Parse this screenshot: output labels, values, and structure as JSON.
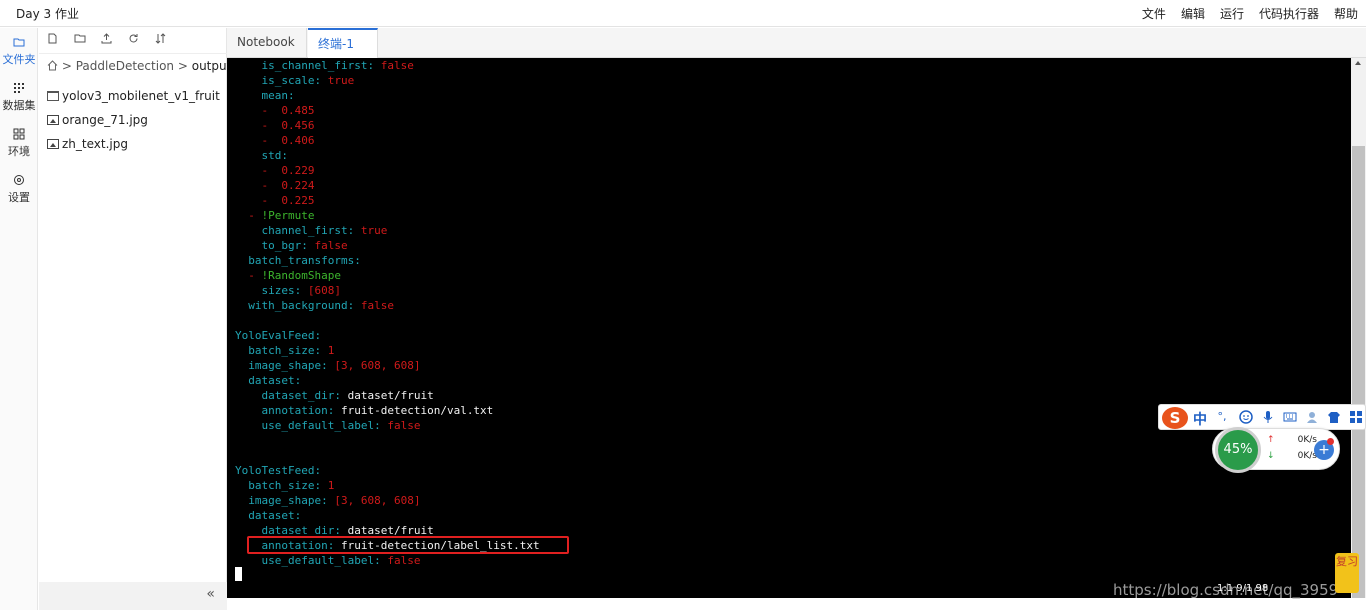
{
  "window": {
    "title": "Day 3 作业"
  },
  "menu": [
    "文件",
    "编辑",
    "运行",
    "代码执行器",
    "帮助"
  ],
  "sidebar": [
    {
      "label": "文件夹",
      "icon": "folder-icon",
      "active": true
    },
    {
      "label": "数据集",
      "icon": "dataset-icon",
      "active": false
    },
    {
      "label": "环境",
      "icon": "environment-icon",
      "active": false
    },
    {
      "label": "设置",
      "icon": "settings-icon",
      "active": false
    }
  ],
  "filepanel": {
    "toolbar_icons": [
      "new-file-icon",
      "new-folder-icon",
      "upload-icon",
      "refresh-icon",
      "sort-icon"
    ],
    "breadcrumb": {
      "root_icon": "home-icon",
      "sep": ">",
      "parent": "PaddleDetection",
      "current": "output"
    },
    "items": [
      {
        "name": "yolov3_mobilenet_v1_fruit",
        "type": "folder"
      },
      {
        "name": "orange_71.jpg",
        "type": "image"
      },
      {
        "name": "zh_text.jpg",
        "type": "image"
      }
    ],
    "collapse": "«"
  },
  "tabs": [
    {
      "label": "Notebook",
      "active": false
    },
    {
      "label": "终端-1",
      "active": true,
      "close": "×"
    }
  ],
  "terminal": {
    "lines": [
      {
        "indent": "    ",
        "key": "is_channel_first",
        "value": "false"
      },
      {
        "indent": "    ",
        "key": "is_scale",
        "value": "true"
      },
      {
        "indent": "    ",
        "key": "mean",
        "value": ""
      },
      {
        "indent": "    ",
        "dash": "- ",
        "value": "0.485"
      },
      {
        "indent": "    ",
        "dash": "- ",
        "value": "0.456"
      },
      {
        "indent": "    ",
        "dash": "- ",
        "value": "0.406"
      },
      {
        "indent": "    ",
        "key": "std",
        "value": ""
      },
      {
        "indent": "    ",
        "dash": "- ",
        "value": "0.229"
      },
      {
        "indent": "    ",
        "dash": "- ",
        "value": "0.224"
      },
      {
        "indent": "    ",
        "dash": "- ",
        "value": "0.225"
      },
      {
        "indent": "  ",
        "dash": "- ",
        "tag": "!Permute"
      },
      {
        "indent": "    ",
        "key": "channel_first",
        "value": "true"
      },
      {
        "indent": "    ",
        "key": "to_bgr",
        "value": "false"
      },
      {
        "indent": "  ",
        "key": "batch_transforms",
        "value": ""
      },
      {
        "indent": "  ",
        "dash": "- ",
        "tag": "!RandomShape"
      },
      {
        "indent": "    ",
        "key": "sizes",
        "value": "[608]"
      },
      {
        "indent": "  ",
        "key": "with_background",
        "value": "false"
      },
      {
        "indent": "",
        "key": "",
        "value": ""
      },
      {
        "indent": "",
        "key": "YoloEvalFeed",
        "value": ""
      },
      {
        "indent": "  ",
        "key": "batch_size",
        "value": "1"
      },
      {
        "indent": "  ",
        "key": "image_shape",
        "value": "[3, 608, 608]"
      },
      {
        "indent": "  ",
        "key": "dataset",
        "value": ""
      },
      {
        "indent": "    ",
        "key": "dataset_dir",
        "text": "dataset/fruit"
      },
      {
        "indent": "    ",
        "key": "annotation",
        "text": "fruit-detection/val.txt"
      },
      {
        "indent": "    ",
        "key": "use_default_label",
        "value": "false"
      },
      {
        "indent": "",
        "key": "",
        "value": ""
      },
      {
        "indent": "",
        "key": "",
        "value": ""
      },
      {
        "indent": "",
        "key": "YoloTestFeed",
        "value": ""
      },
      {
        "indent": "  ",
        "key": "batch_size",
        "value": "1"
      },
      {
        "indent": "  ",
        "key": "image_shape",
        "value": "[3, 608, 608]"
      },
      {
        "indent": "  ",
        "key": "dataset",
        "value": ""
      },
      {
        "indent": "    ",
        "key": "dataset_dir",
        "text": "dataset/fruit"
      },
      {
        "indent": "    ",
        "key": "annotation",
        "text": "fruit-detection/label_list.txt"
      },
      {
        "indent": "    ",
        "key": "use_default_label",
        "value": "false"
      }
    ],
    "highlight_color": "#e02020"
  },
  "ime": {
    "logo": "S",
    "mode": "中",
    "punct": "°,",
    "icons": [
      "emoji-icon",
      "mic-icon",
      "keyboard-icon",
      "user-icon",
      "skin-icon",
      "grid-icon"
    ]
  },
  "speed_widget": {
    "percent": "45%",
    "up": "0K/s",
    "down": "0K/s",
    "up_arrow": "↑",
    "down_arrow": "↓",
    "plus": "+"
  },
  "watermark": {
    "text": "https://blog.csdn.net/qq_3959",
    "overlay": "1:1  9/1  98"
  },
  "side_widget": {
    "text": "复习"
  },
  "colors": {
    "key": "#21a6b5",
    "value": "#d01a1a",
    "tag": "#3cb52d",
    "plain": "#f2f2f2",
    "accent": "#2a6fd6"
  }
}
